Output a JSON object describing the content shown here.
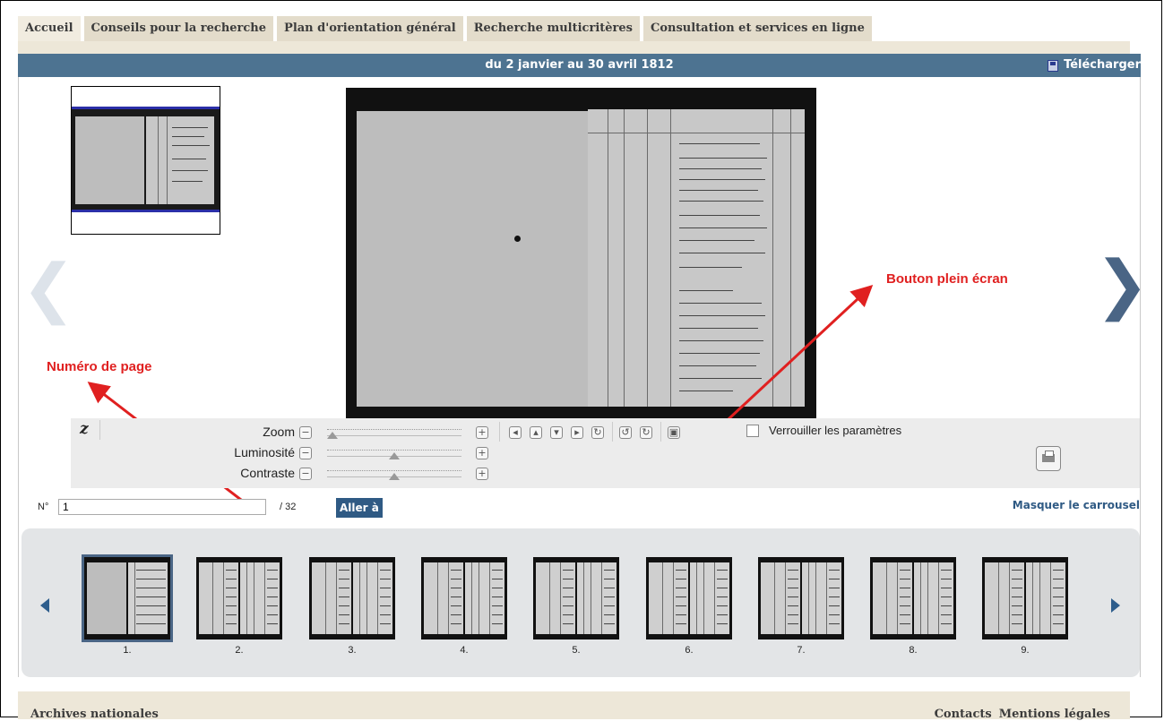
{
  "tabs": [
    "Accueil",
    "Conseils pour la recherche",
    "Plan d'orientation général",
    "Recherche multicritères",
    "Consultation et services en ligne"
  ],
  "header": {
    "title": "du 2 janvier au 30 avril 1812",
    "download_label": "Télécharger"
  },
  "annotations": {
    "page_number": "Numéro de page",
    "fullscreen_button": "Bouton plein écran"
  },
  "toolbar": {
    "logo": "z",
    "zoom_label": "Zoom",
    "brightness_label": "Luminosité",
    "contrast_label": "Contraste",
    "zoom_level": 0,
    "brightness_level": 0.5,
    "contrast_level": 0.5,
    "lock_label": "Verrouiller les paramètres"
  },
  "pager": {
    "prefix": "N°",
    "value": "1",
    "total": "/ 32",
    "go_label": "Aller à",
    "hide_carousel": "Masquer le carrousel"
  },
  "carousel": {
    "items": [
      "1.",
      "2.",
      "3.",
      "4.",
      "5.",
      "6.",
      "7.",
      "8.",
      "9."
    ],
    "selected": 0
  },
  "footer": {
    "left": "Archives nationales",
    "contacts": "Contacts",
    "legal": "Mentions légales"
  },
  "colors": {
    "header_bg": "#4d7391",
    "tab_bg": "#e3dccb",
    "annotation": "#e02020",
    "accent": "#2d5d8c"
  }
}
